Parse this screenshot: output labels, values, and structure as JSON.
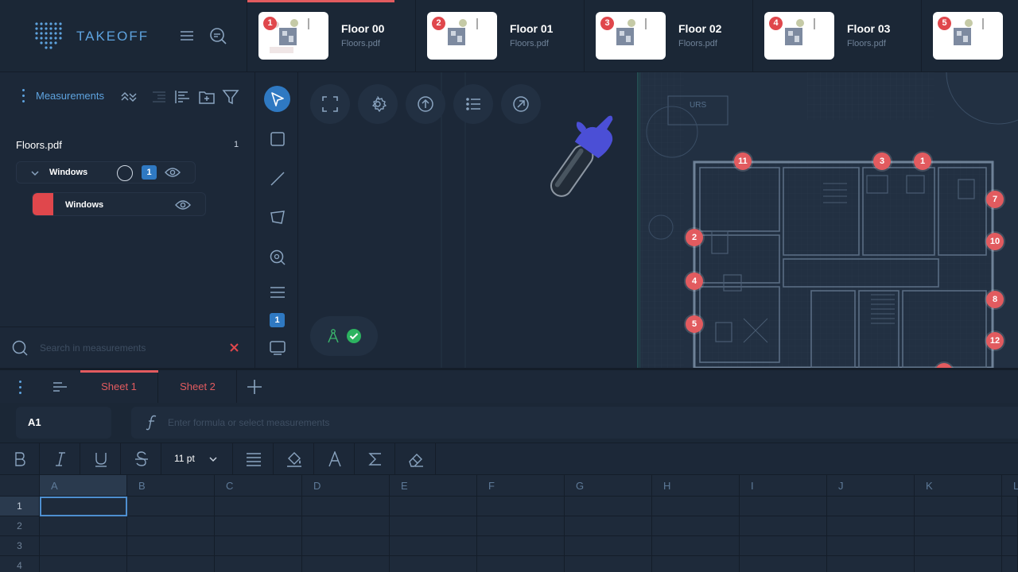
{
  "app": {
    "name": "TAKEOFF"
  },
  "floors": [
    {
      "num": "1",
      "title": "Floor 00",
      "file": "Floors.pdf",
      "active": true
    },
    {
      "num": "2",
      "title": "Floor 01",
      "file": "Floors.pdf"
    },
    {
      "num": "3",
      "title": "Floor 02",
      "file": "Floors.pdf"
    },
    {
      "num": "4",
      "title": "Floor 03",
      "file": "Floors.pdf"
    },
    {
      "num": "5",
      "title": "",
      "file": ""
    }
  ],
  "measurements": {
    "label": "Measurements",
    "file": {
      "name": "Floors.pdf",
      "count": "1"
    },
    "group": {
      "label": "Windows",
      "badge": "1"
    },
    "item": {
      "label": "Windows",
      "color": "#e0474c"
    },
    "search_placeholder": "Search in measurements"
  },
  "tools": {
    "badge": "1"
  },
  "pins": [
    "11",
    "3",
    "1",
    "7",
    "2",
    "10",
    "4",
    "8",
    "5",
    "12"
  ],
  "sheets": [
    "Sheet 1",
    "Sheet 2"
  ],
  "formula": {
    "cell": "A1",
    "placeholder": "Enter formula or select measurements"
  },
  "format": {
    "font_size": "11 pt"
  },
  "grid": {
    "columns": [
      "A",
      "B",
      "C",
      "D",
      "E",
      "F",
      "G",
      "H",
      "I",
      "J",
      "K",
      "L"
    ],
    "rows": [
      "1",
      "2",
      "3",
      "4"
    ]
  },
  "colors": {
    "accent": "#5ea3df",
    "danger": "#e25b5f",
    "primary": "#2f79c2",
    "bg": "#1c2838"
  }
}
